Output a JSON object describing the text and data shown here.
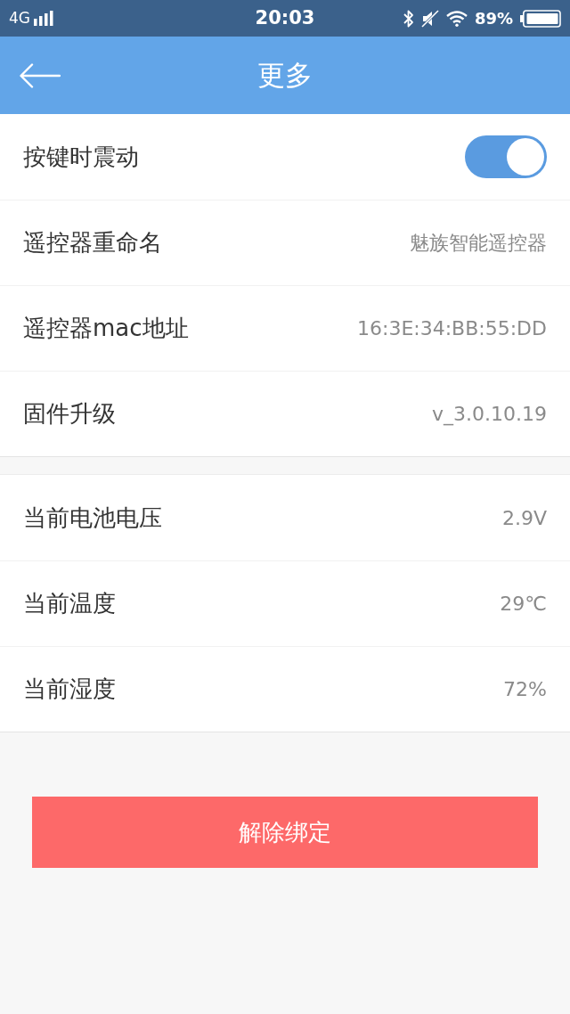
{
  "status_bar": {
    "network": "4G",
    "time": "20:03",
    "battery": "89%"
  },
  "header": {
    "title": "更多"
  },
  "sections": [
    {
      "rows": [
        {
          "kind": "toggle",
          "label": "按键时震动",
          "on": true
        },
        {
          "kind": "value",
          "label": "遥控器重命名",
          "value": "魅族智能遥控器"
        },
        {
          "kind": "value",
          "label": "遥控器mac地址",
          "value": "16:3E:34:BB:55:DD"
        },
        {
          "kind": "value",
          "label": "固件升级",
          "value": "v_3.0.10.19"
        }
      ]
    },
    {
      "rows": [
        {
          "kind": "value",
          "label": "当前电池电压",
          "value": "2.9V"
        },
        {
          "kind": "value",
          "label": "当前温度",
          "value": "29℃"
        },
        {
          "kind": "value",
          "label": "当前湿度",
          "value": "72%"
        }
      ]
    }
  ],
  "unbind_button": {
    "label": "解除绑定"
  }
}
